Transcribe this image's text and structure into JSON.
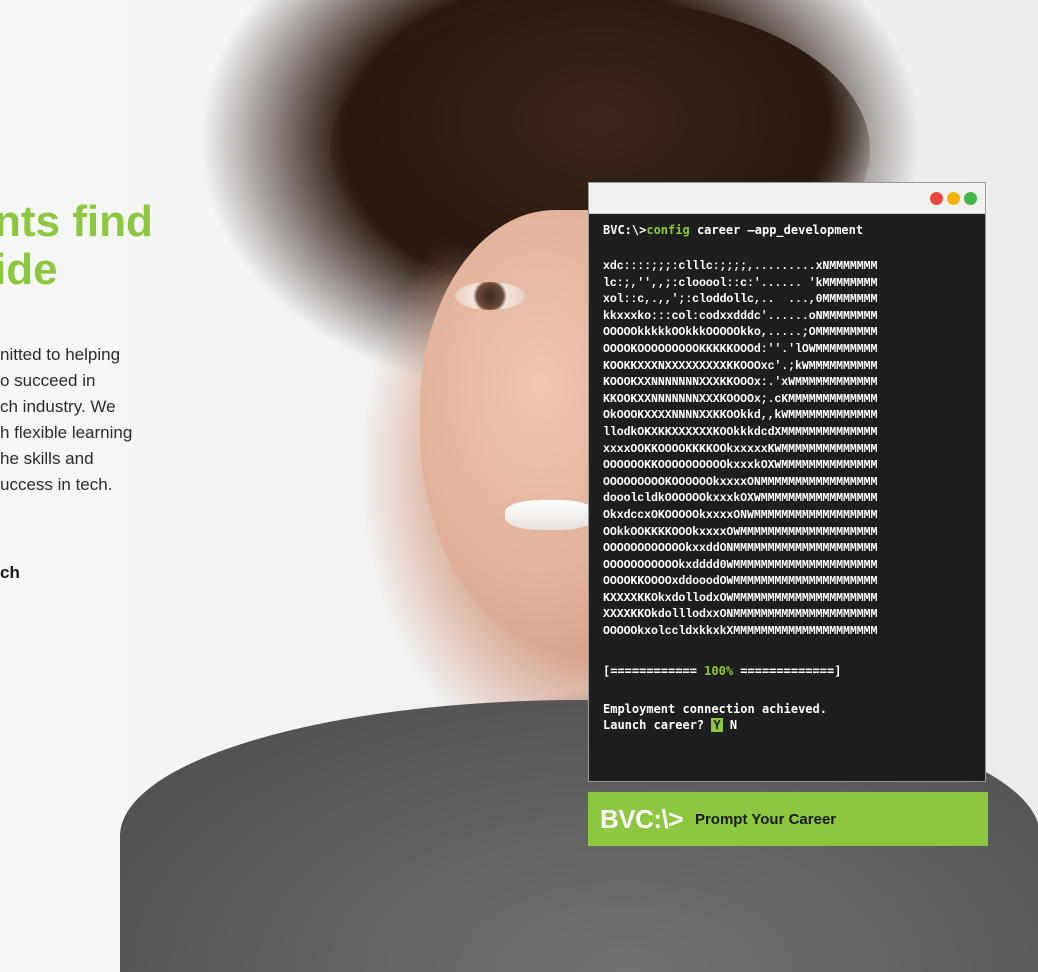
{
  "hero": {
    "title_line1": "nts find",
    "title_line2": "ide",
    "body": "nitted to helping\no succeed in\nch industry. We\nh flexible learning\nhe skills and\nuccess in tech.",
    "link": "ch"
  },
  "terminal": {
    "prompt_prefix": "BVC:\\>",
    "command": "config",
    "args": " career –app_development",
    "ascii_art": "xdc::::;;;:clllc:;;;;,.........xNMMMMMMM\nlc:;,'',,;:clooool::c:'...... 'kMMMMMMMM\nxol::c,.,,';:cloddollc,..  ...,0MMMMMMMM\nkkxxxko:::col:codxxdddc'......oNMMMMMMMM\nOOOOOkkkkkOOkkkOOOOOkko,.....;OMMMMMMMMM\nOOOOKOOOOOOOOOKKKKKOOOd:''.'lOWMMMMMMMMM\nKOOKKXXXNXXXXXXXXXKKOOOxc'.;kWMMMMMMMMMM\nKOOOKXXNNNNNNNXXXKKOOOx:.'xWMMMMMMMMMMMM\nKKOOKXXNNNNNNNXXXKOOOOx;.cKMMMMMMMMMMMMM\nOkOOOKXXXXNNNNXXKKOOkkd,,kWMMMMMMMMMMMMM\nllodkOKXKKXXXXXXKOOkkkdcdXMMMMMMMMMMMMMM\nxxxxOOKKOOOOKKKKOOkxxxxxKWMMMMMMMMMMMMMM\nOOOOOOKKOOOOOOOOOOkxxxkOXWMMMMMMMMMMMMMM\nOOOOOOOOOKOOOOOOkxxxxONMMMMMMMMMMMMMMMMM\ndooolcldkOOOOOOkxxxkOXWMMMMMMMMMMMMMMMMM\nOkxdccxOKOOOOOkxxxxONWMMMMMMMMMMMMMMMMMM\nOOkkOOKKKKOOOkxxxxOWMMMMMMMMMMMMMMMMMMMM\nOOOOOOOOOOOOkxxddONMMMMMMMMMMMMMMMMMMMMM\nOOOOOOOOOOOkxdddd0WMMMMMMMMMMMMMMMMMMMMM\nOOOOKKOOOOxddooodOWMMMMMMMMMMMMMMMMMMMMM\nKXXXXKKOkxdollodxOWMMMMMMMMMMMMMMMMMMMMM\nXXXXKKOkdolllodxxONMMMMMMMMMMMMMMMMMMMMM\nOOOOOkxolccldxkkxkXMMMMMMMMMMMMMMMMMMMMM",
    "progress_left": "[============ ",
    "progress_pct": "100%",
    "progress_right": " =============]",
    "message": "Employment connection achieved.",
    "question": "Launch career? ",
    "yes": "Y",
    "no": " N"
  },
  "banner": {
    "logo": "BVC:\\>",
    "text": "Prompt Your Career"
  },
  "colors": {
    "accent": "#8dc63f",
    "terminal_bg": "#1e1e1e"
  }
}
